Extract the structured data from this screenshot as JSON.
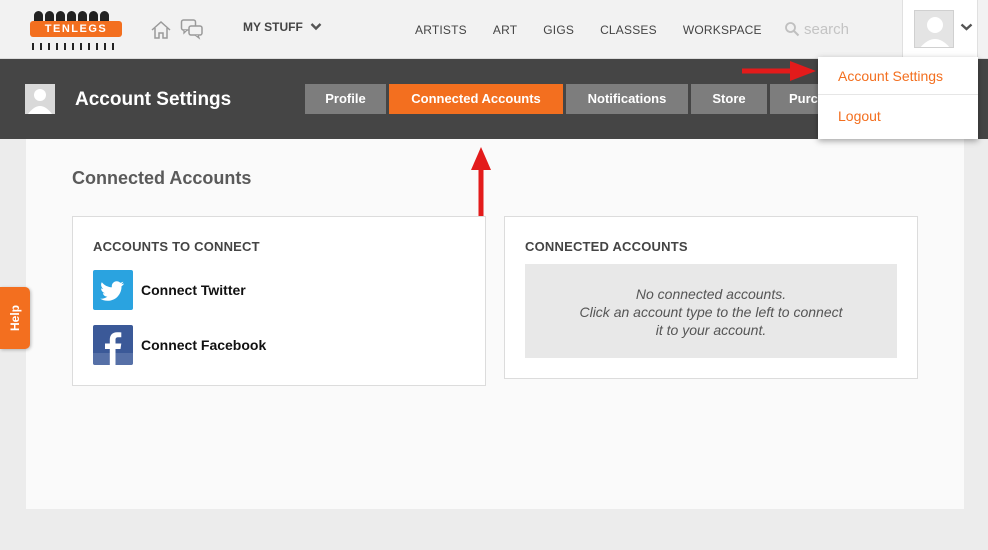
{
  "app": {
    "logo_text": "TENLEGS"
  },
  "topnav": {
    "my_stuff_label": "MY STUFF",
    "links": [
      "ARTISTS",
      "ART",
      "GIGS",
      "CLASSES",
      "WORKSPACE"
    ],
    "search_placeholder": "search"
  },
  "user_menu": {
    "items": [
      "Account Settings",
      "Logout"
    ]
  },
  "header": {
    "title": "Account Settings",
    "tabs": [
      {
        "label": "Profile",
        "active": false
      },
      {
        "label": "Connected Accounts",
        "active": true
      },
      {
        "label": "Notifications",
        "active": false
      },
      {
        "label": "Store",
        "active": false
      },
      {
        "label": "Purch",
        "active": false
      }
    ]
  },
  "main": {
    "section_title": "Connected Accounts",
    "to_connect": {
      "heading": "ACCOUNTS TO CONNECT",
      "items": [
        {
          "label": "Connect Twitter",
          "icon": "twitter-icon"
        },
        {
          "label": "Connect Facebook",
          "icon": "facebook-icon"
        }
      ]
    },
    "connected": {
      "heading": "CONNECTED ACCOUNTS",
      "empty_line1": "No connected accounts.",
      "empty_line2": "Click an account type to the left to connect",
      "empty_line3": "it to your account."
    }
  },
  "help": {
    "label": "Help"
  },
  "colors": {
    "accent": "#f36f1f",
    "dark_header": "#454545",
    "tab_inactive": "#7d7d7d",
    "annotation": "#e31b1b"
  }
}
